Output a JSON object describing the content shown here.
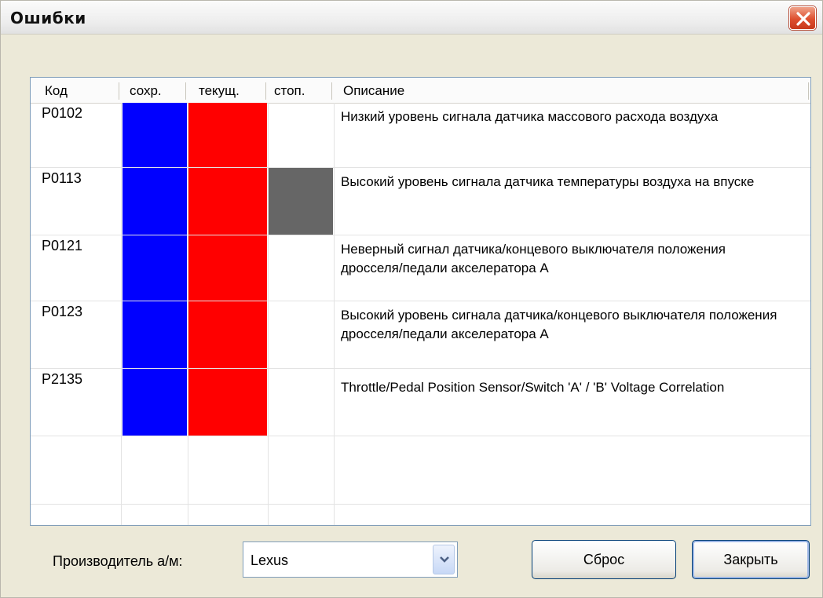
{
  "window": {
    "title": "Ошибки"
  },
  "columns": [
    "Код",
    "сохр.",
    "текущ.",
    "стоп.",
    "Описание"
  ],
  "errors": [
    {
      "code": "P0102",
      "saved": true,
      "current": true,
      "stop": false,
      "description": "Низкий уровень сигнала датчика массового расхода воздуха"
    },
    {
      "code": "P0113",
      "saved": true,
      "current": true,
      "stop": true,
      "description": "Высокий уровень сигнала датчика температуры воздуха на впуске"
    },
    {
      "code": "P0121",
      "saved": true,
      "current": true,
      "stop": false,
      "description": "Неверный сигнал датчика/концевого выключателя положения дросселя/педали акселератора А"
    },
    {
      "code": "P0123",
      "saved": true,
      "current": true,
      "stop": false,
      "description": "Высокий уровень сигнала датчика/концевого выключателя положения дросселя/педали акселератора А"
    },
    {
      "code": "P2135",
      "saved": true,
      "current": true,
      "stop": false,
      "description": "Throttle/Pedal Position Sensor/Switch 'A' / 'B' Voltage Correlation"
    }
  ],
  "colors": {
    "saved": "#0000ff",
    "current": "#ff0000",
    "stop": "#666666"
  },
  "manufacturer": {
    "label": "Производитель а/м:",
    "value": "Lexus"
  },
  "buttons": {
    "reset": "Сброс",
    "close": "Закрыть"
  },
  "icons": {
    "close": "close-icon",
    "dropdown": "chevron-down-icon"
  }
}
